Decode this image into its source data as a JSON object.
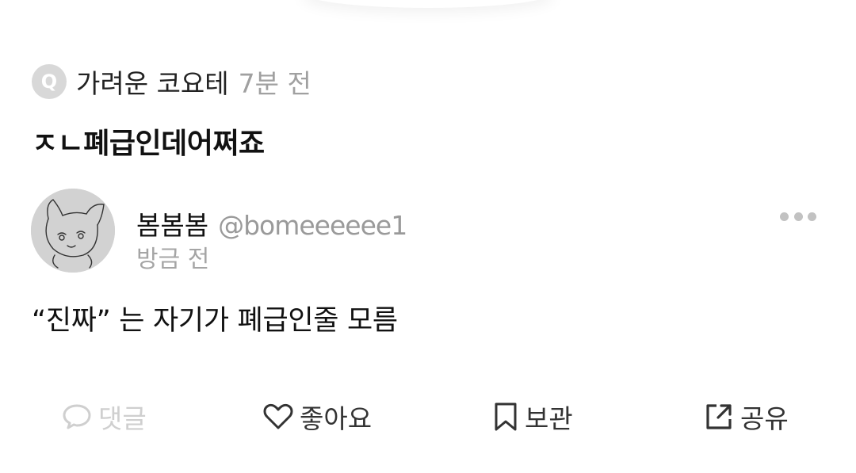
{
  "question": {
    "badge": "Q",
    "author": "가려운 코요테",
    "time": "7분 전",
    "text": "ㅈㄴ폐급인데어쩌죠"
  },
  "answer": {
    "name": "봄봄봄",
    "handle": "@bomeeeeee1",
    "time": "방금 전",
    "text": "“진짜” 는 자기가 폐급인줄 모름",
    "avatar_icon": "cat-drawing-avatar"
  },
  "actions": [
    {
      "label": "댓글",
      "icon": "comment-icon",
      "enabled": false
    },
    {
      "label": "좋아요",
      "icon": "heart-icon",
      "enabled": true
    },
    {
      "label": "보관",
      "icon": "bookmark-icon",
      "enabled": true
    },
    {
      "label": "공유",
      "icon": "share-icon",
      "enabled": true
    }
  ],
  "colors": {
    "text_primary": "#111111",
    "text_muted": "#a0a0a0",
    "disabled": "#cfcfcf",
    "badge_bg": "#d8d8d8"
  }
}
